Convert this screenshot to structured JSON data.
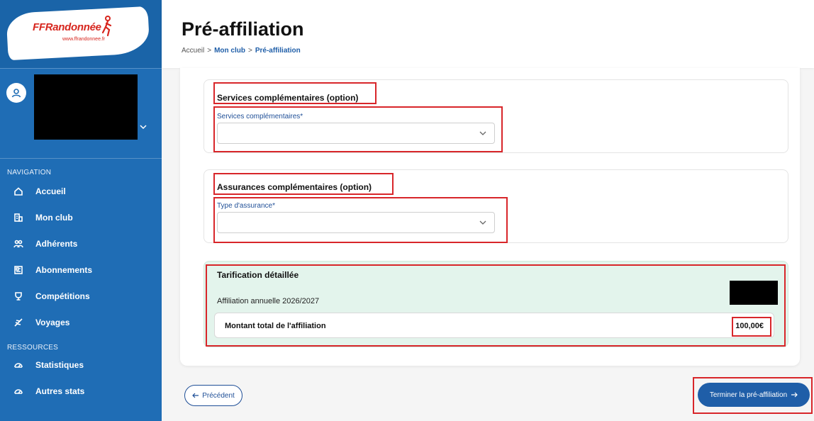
{
  "sidebar": {
    "logo_text": "FFRandonnée",
    "logo_url": "www.ffrandonnee.fr",
    "nav_section_label": "NAVIGATION",
    "nav_items": [
      {
        "label": "Accueil",
        "icon": "home-icon"
      },
      {
        "label": "Mon club",
        "icon": "building-icon"
      },
      {
        "label": "Adhérents",
        "icon": "users-icon"
      },
      {
        "label": "Abonnements",
        "icon": "newspaper-icon"
      },
      {
        "label": "Compétitions",
        "icon": "trophy-icon"
      },
      {
        "label": "Voyages",
        "icon": "plane-icon"
      }
    ],
    "resources_section_label": "RESSOURCES",
    "resource_items": [
      {
        "label": "Statistiques",
        "icon": "gauge-icon"
      },
      {
        "label": "Autres stats",
        "icon": "gauge-icon"
      }
    ]
  },
  "header": {
    "title": "Pré-affiliation",
    "breadcrumb": [
      "Accueil",
      "Mon club",
      "Pré-affiliation"
    ],
    "breadcrumb_sep": ">"
  },
  "services": {
    "title": "Services complémentaires (option)",
    "field_label": "Services complémentaires*",
    "value": ""
  },
  "assurances": {
    "title": "Assurances complémentaires (option)",
    "field_label": "Type d'assurance*",
    "value": ""
  },
  "tarification": {
    "title": "Tarification détaillée",
    "row_label": "Affiliation annuelle 2026/2027",
    "total_label": "Montant total de l'affiliation",
    "total_value": "100,00€"
  },
  "footer": {
    "prev_label": "Précédent",
    "next_label": "Terminer la pré-affiliation"
  },
  "colors": {
    "sidebar_bg": "#1f6db5",
    "accent": "#1f5ea8",
    "highlight_red": "#d8262a",
    "tarif_bg": "#e3f4ec"
  }
}
